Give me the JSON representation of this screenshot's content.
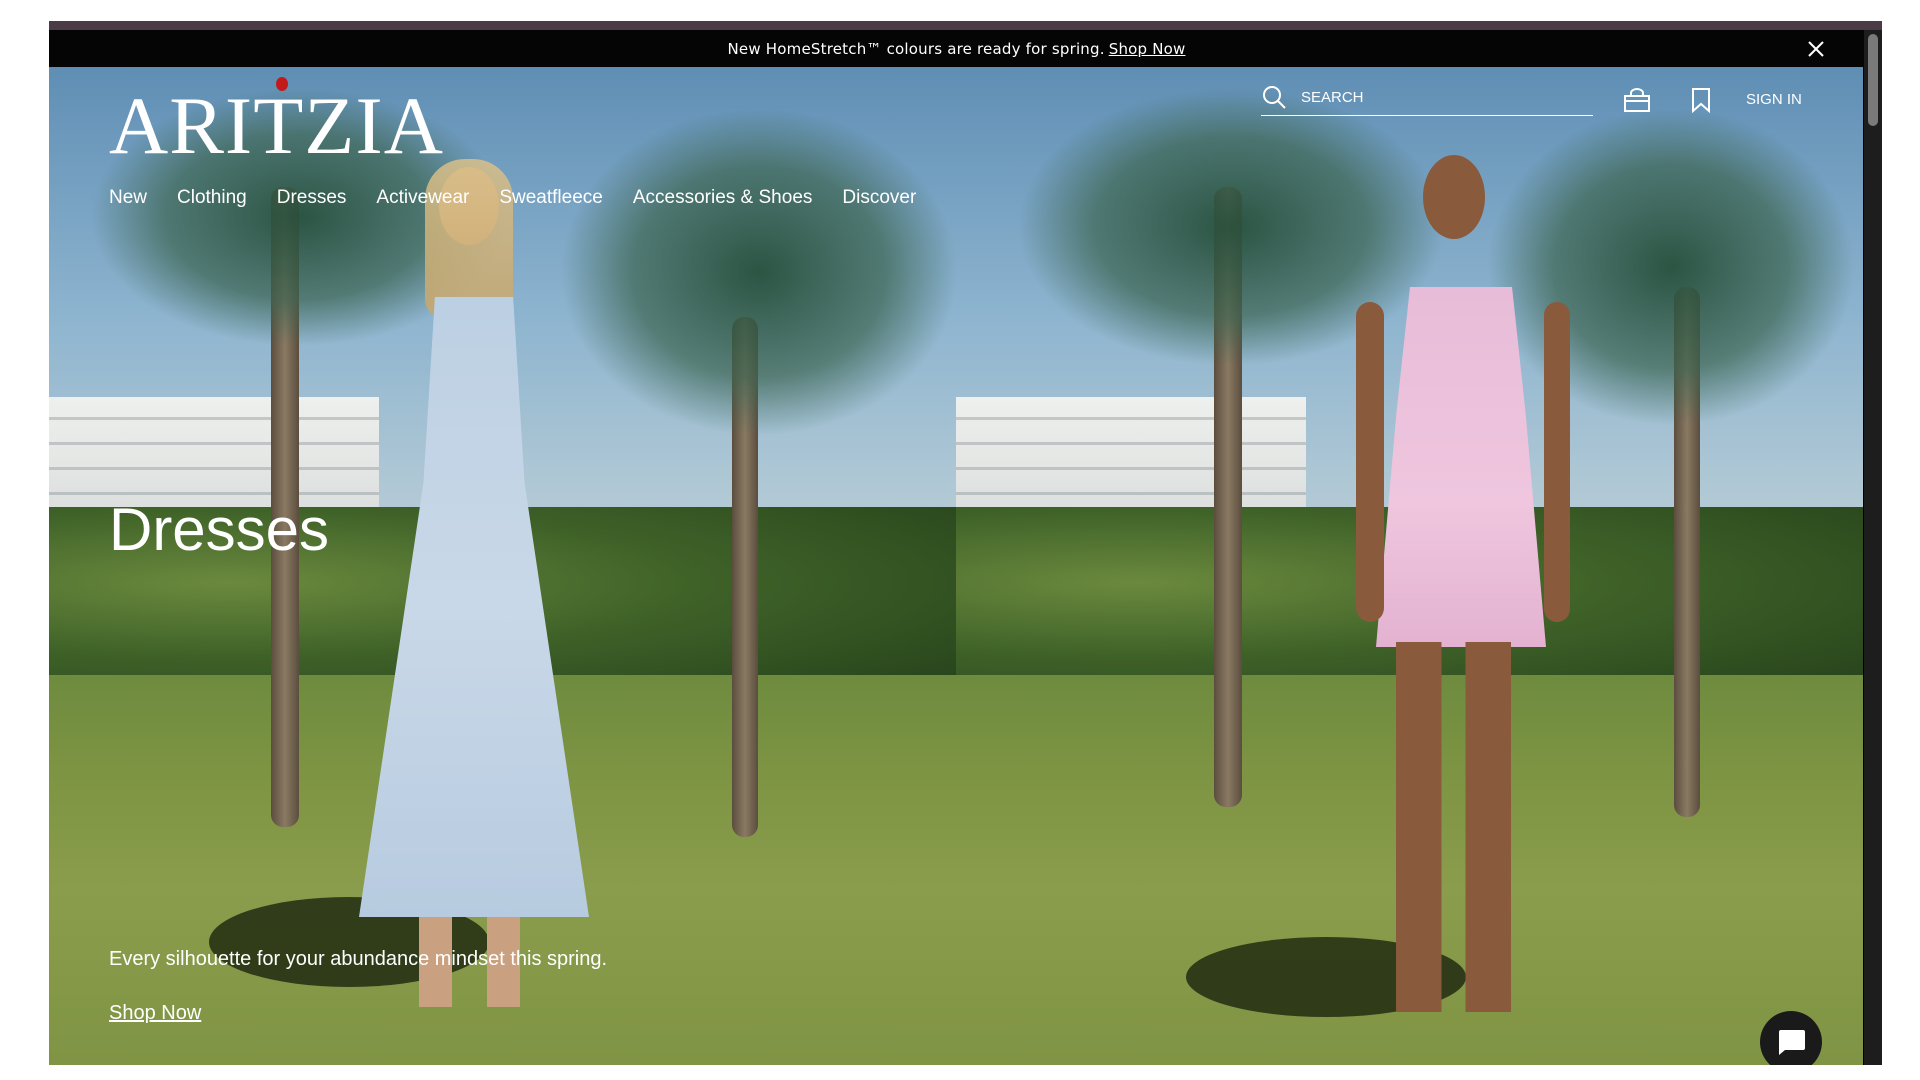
{
  "announcement": {
    "text": "New HomeStretch™ colours are ready for spring.",
    "link": "Shop Now",
    "close_icon": "close-icon"
  },
  "header": {
    "logo": "ARITZIA",
    "nav": [
      "New",
      "Clothing",
      "Dresses",
      "Activewear",
      "Sweatfleece",
      "Accessories & Shoes",
      "Discover"
    ],
    "search_placeholder": "SEARCH",
    "sign_in": "SIGN IN",
    "icons": [
      "search-icon",
      "shopping-bag-icon",
      "bookmark-icon"
    ]
  },
  "hero": {
    "title": "Dresses",
    "subtitle": "Every silhouette for your abundance mindset this spring.",
    "cta": "Shop Now"
  },
  "chat": {
    "icon": "chat-bubble-icon"
  },
  "colors": {
    "announcement_bg": "#050505",
    "text": "#ffffff",
    "logo_accent": "#c21a1a",
    "chat_bg": "#1a1a1a"
  }
}
